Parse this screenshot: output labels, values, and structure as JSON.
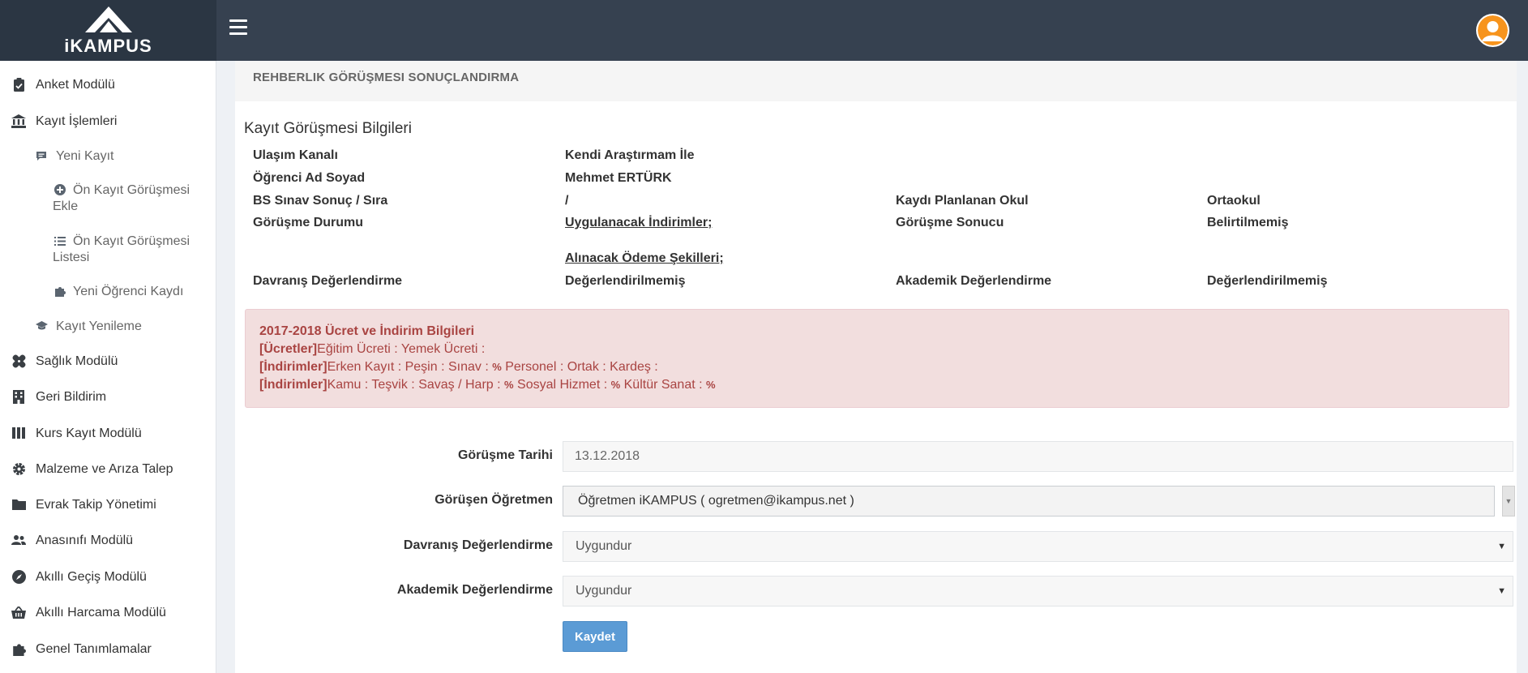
{
  "header": {
    "logo_text": "iKAMPUS",
    "colors": {
      "topbar": "#364150",
      "logo_bg": "#2b3643",
      "avatar_orange": "#f7941d"
    }
  },
  "sidebar": {
    "items": [
      {
        "label": "Anket Modülü",
        "icon": "clipboard-icon"
      },
      {
        "label": "Kayıt İşlemleri",
        "icon": "bank-icon"
      },
      {
        "label": "Yeni Kayıt",
        "icon": "comment-icon"
      },
      {
        "label": "Ön Kayıt Görüşmesi Ekle",
        "icon": "plus-circle-icon"
      },
      {
        "label": "Ön Kayıt Görüşmesi Listesi",
        "icon": "list-icon"
      },
      {
        "label": "Yeni Öğrenci Kaydı",
        "icon": "puzzle-icon"
      },
      {
        "label": "Kayıt Yenileme",
        "icon": "graduation-cap-icon"
      },
      {
        "label": "Sağlık Modülü",
        "icon": "bandage-icon"
      },
      {
        "label": "Geri Bildirim",
        "icon": "building-icon"
      },
      {
        "label": "Kurs Kayıt Modülü",
        "icon": "columns-icon"
      },
      {
        "label": "Malzeme ve Arıza Talep",
        "icon": "gear-icon"
      },
      {
        "label": "Evrak Takip Yönetimi",
        "icon": "folder-icon"
      },
      {
        "label": "Anasınıfı Modülü",
        "icon": "users-icon"
      },
      {
        "label": "Akıllı Geçiş Modülü",
        "icon": "compass-icon"
      },
      {
        "label": "Akıllı Harcama Modülü",
        "icon": "basket-icon"
      },
      {
        "label": "Genel Tanımlamalar",
        "icon": "puzzle-icon"
      }
    ]
  },
  "main": {
    "panel_title": "REHBERLIK GÖRÜŞMESI SONUÇLANDIRMA",
    "section_title": "Kayıt Görüşmesi Bilgileri",
    "info": {
      "ulasim_label": "Ulaşım Kanalı",
      "ulasim_value": "Kendi Araştırmam İle",
      "ogrenci_label": "Öğrenci Ad Soyad",
      "ogrenci_value": "Mehmet ERTÜRK",
      "bs_label": "BS Sınav Sonuç / Sıra",
      "bs_value": "/",
      "okul_label": "Kaydı Planlanan Okul",
      "okul_value": "Ortaokul",
      "durum_label": "Görüşme Durumu",
      "indirim_link": "Uygulanacak İndirimler;",
      "sonuc_label": "Görüşme Sonucu",
      "sonuc_value": "Belirtilmemiş",
      "odeme_link": "Alınacak Ödeme Şekilleri;",
      "davranis_label": "Davranış Değerlendirme",
      "davranis_value": "Değerlendirilmemiş",
      "akademik_label": "Akademik Değerlendirme",
      "akademik_value": "Değerlendirilmemiş"
    },
    "alert": {
      "title": "2017-2018 Ücret ve İndirim Bilgileri",
      "line1_tag": "[Ücretler]",
      "line1_text": "Eğitim Ücreti : Yemek Ücreti :",
      "line2_tag": "[İndirimler]",
      "line2_text_a": "Erken Kayıt : Peşin : Sınav : ",
      "line2_pct": "%",
      "line2_text_b": " Personel : Ortak : Kardeş :",
      "line3_tag": "[İndirimler]",
      "line3_text_a": "Kamu : Teşvik : Savaş / Harp : ",
      "line3_pct_a": "%",
      "line3_text_b": " Sosyal Hizmet : ",
      "line3_pct_b": "%",
      "line3_text_c": " Kültür Sanat : ",
      "line3_pct_c": "%"
    },
    "form": {
      "date_label": "Görüşme Tarihi",
      "date_value": "13.12.2018",
      "teacher_label": "Görüşen Öğretmen",
      "teacher_value": "Öğretmen iKAMPUS ( ogretmen@ikampus.net )",
      "davranis_label": "Davranış Değerlendirme",
      "davranis_value": "Uygundur",
      "akademik_label": "Akademik Değerlendirme",
      "akademik_value": "Uygundur",
      "save_label": "Kaydet"
    }
  }
}
